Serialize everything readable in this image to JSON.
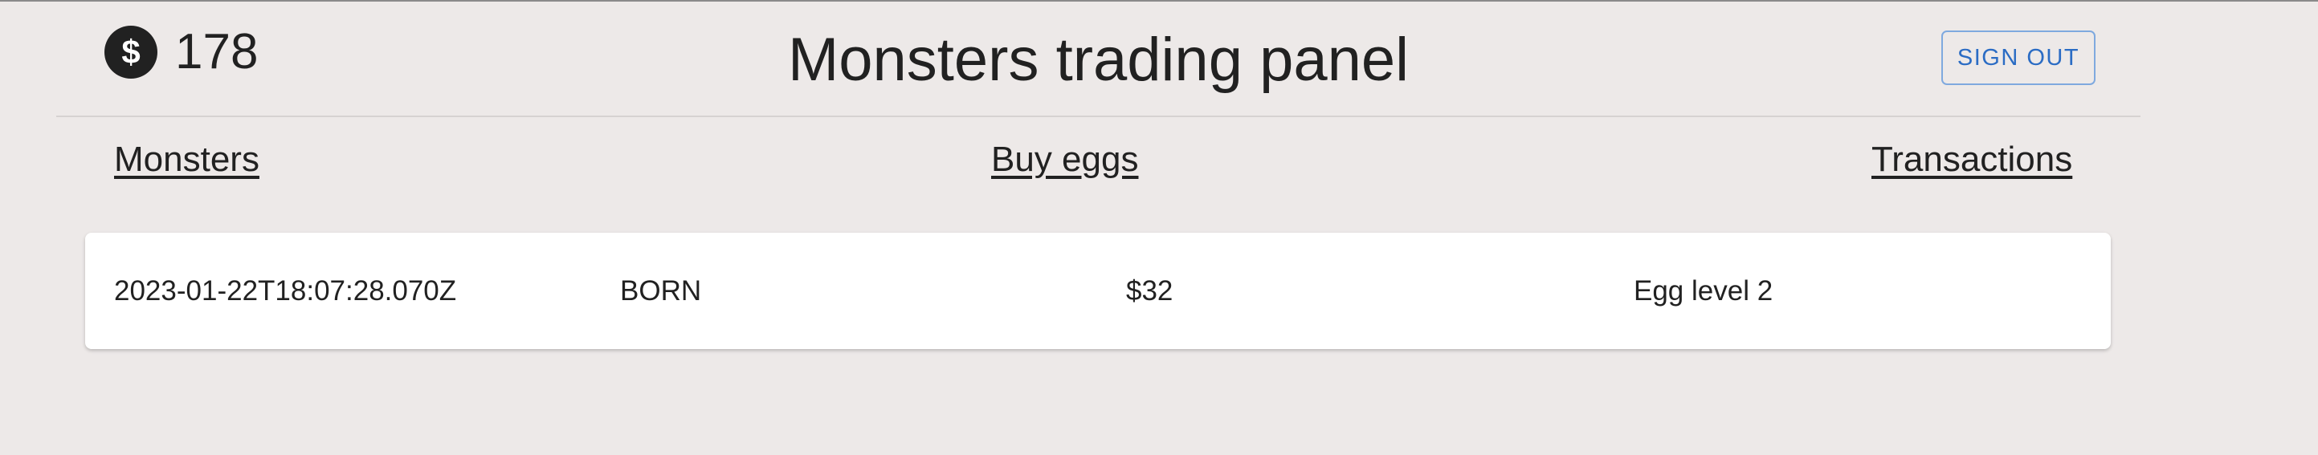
{
  "header": {
    "balance": "178",
    "balance_icon": "dollar-coin-icon",
    "title": "Monsters trading panel",
    "signout_label": "SIGN OUT"
  },
  "nav": {
    "monsters": "Monsters",
    "buy_eggs": "Buy eggs",
    "transactions": "Transactions"
  },
  "transactions": [
    {
      "timestamp": "2023-01-22T18:07:28.070Z",
      "status": "BORN",
      "price": "$32",
      "item": "Egg level 2"
    }
  ],
  "colors": {
    "background": "#ede9e8",
    "card": "#ffffff",
    "accent": "#2b6cc4",
    "text": "#212121"
  }
}
